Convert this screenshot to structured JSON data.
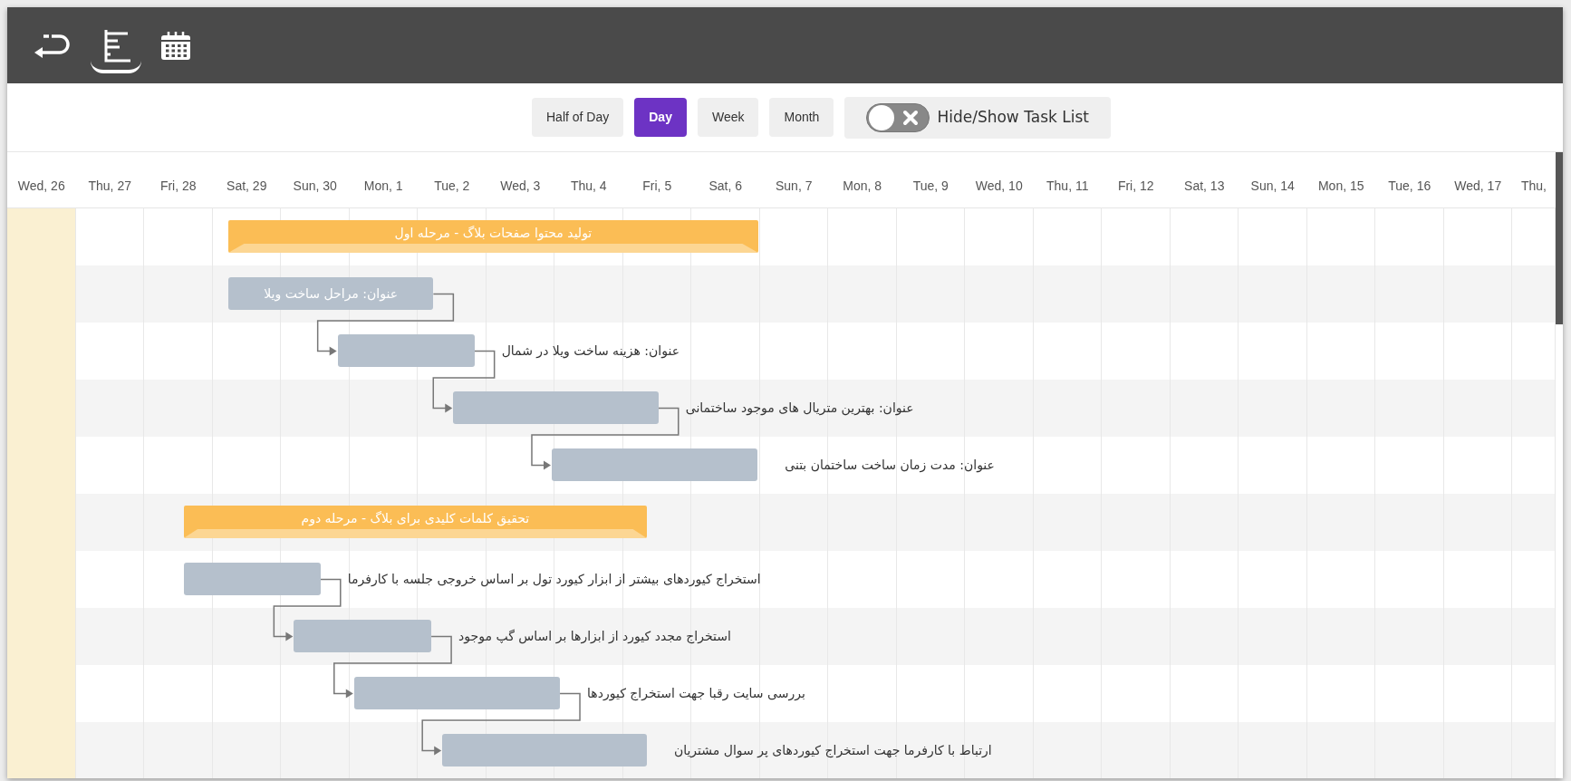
{
  "view_icons": [
    {
      "kind": "back",
      "selected": false
    },
    {
      "kind": "list",
      "selected": true
    },
    {
      "kind": "calendar",
      "selected": false
    }
  ],
  "scales": [
    {
      "label": "Half of Day",
      "selected": false
    },
    {
      "label": "Day",
      "selected": true
    },
    {
      "label": "Week",
      "selected": false
    },
    {
      "label": "Month",
      "selected": false
    }
  ],
  "task_list_toggle": {
    "label": "Hide/Show Task List",
    "on": false
  },
  "timeline": {
    "days": [
      {
        "label": "Wed, 26",
        "today": true
      },
      {
        "label": "Thu, 27",
        "today": false
      },
      {
        "label": "Fri, 28",
        "today": false
      },
      {
        "label": "Sat, 29",
        "today": false
      },
      {
        "label": "Sun, 30",
        "today": false
      },
      {
        "label": "Mon, 1",
        "today": false
      },
      {
        "label": "Tue, 2",
        "today": false
      },
      {
        "label": "Wed, 3",
        "today": false
      },
      {
        "label": "Thu, 4",
        "today": false
      },
      {
        "label": "Fri, 5",
        "today": false
      },
      {
        "label": "Sat, 6",
        "today": false
      },
      {
        "label": "Sun, 7",
        "today": false
      },
      {
        "label": "Mon, 8",
        "today": false
      },
      {
        "label": "Tue, 9",
        "today": false
      },
      {
        "label": "Wed, 10",
        "today": false
      },
      {
        "label": "Thu, 11",
        "today": false
      },
      {
        "label": "Fri, 12",
        "today": false
      },
      {
        "label": "Sat, 13",
        "today": false
      },
      {
        "label": "Sun, 14",
        "today": false
      },
      {
        "label": "Mon, 15",
        "today": false
      },
      {
        "label": "Tue, 16",
        "today": false
      },
      {
        "label": "Wed, 17",
        "today": false
      },
      {
        "label": "Thu,",
        "today": false
      }
    ]
  },
  "tasks": [
    {
      "kind": "project",
      "label": "تولید محتوا صفحات بلاگ - مرحله اول"
    },
    {
      "kind": "task",
      "label": "عنوان: مراحل ساخت ویلا"
    },
    {
      "kind": "task",
      "label": "عنوان: هزینه ساخت ویلا در شمال"
    },
    {
      "kind": "task",
      "label": "عنوان: بهترین متریال های موجود ساختمانی"
    },
    {
      "kind": "task",
      "label": "عنوان: مدت زمان ساخت ساختمان بتنی"
    },
    {
      "kind": "project",
      "label": "تحقیق کلمات کلیدی برای بلاگ - مرحله دوم"
    },
    {
      "kind": "task",
      "label": "استخراج کیوردهای بیشتر از ابزار کیورد تول بر اساس خروجی جلسه با کارفرما"
    },
    {
      "kind": "task",
      "label": "استخراج مجدد کیورد از ابزارها بر اساس گپ موجود"
    },
    {
      "kind": "task",
      "label": "بررسی سایت رقبا جهت استخراج کیوردها"
    },
    {
      "kind": "task",
      "label": "ارتباط با کارفرما جهت استخراج کیوردهای پر سوال مشتریان"
    }
  ]
}
